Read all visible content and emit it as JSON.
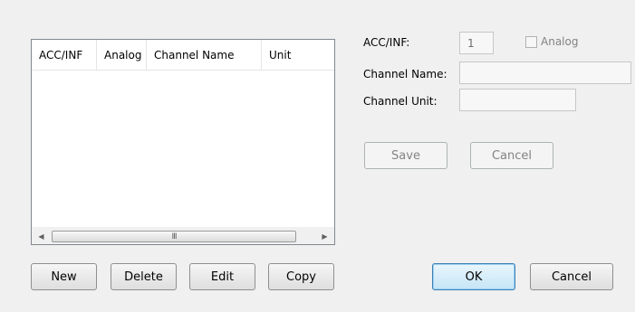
{
  "list": {
    "columns": [
      "ACC/INF",
      "Analog",
      "Channel Name",
      "Unit"
    ],
    "rows": []
  },
  "scrollbar": {
    "grip_glyph": "III"
  },
  "left_buttons": {
    "new": "New",
    "delete": "Delete",
    "edit": "Edit",
    "copy": "Copy"
  },
  "form": {
    "acc_inf_label": "ACC/INF:",
    "acc_inf_value": "1",
    "analog_label": "Analog",
    "analog_checked": false,
    "channel_name_label": "Channel Name:",
    "channel_name_value": "",
    "channel_unit_label": "Channel Unit:",
    "channel_unit_value": "",
    "save": "Save",
    "cancel": "Cancel"
  },
  "dialog_buttons": {
    "ok": "OK",
    "cancel": "Cancel"
  }
}
